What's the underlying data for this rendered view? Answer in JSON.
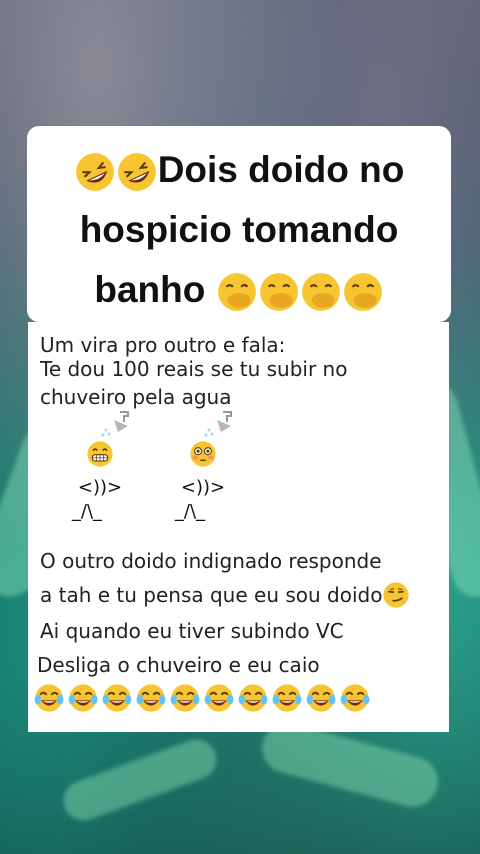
{
  "title": {
    "text": "Dois doido no hospicio tomando banho"
  },
  "body": {
    "line1": "Um vira pro outro e fala:",
    "line2": "Te dou 100 reais se tu subir no",
    "line3": "chuveiro pela agua",
    "figure_body": "<))>",
    "figure_legs": "_/\\_",
    "line4": "O outro doido indignado responde",
    "line5": "a tah e tu pensa que eu sou doido",
    "line6": "Ai quando eu tiver subindo VC",
    "line7": "Desliga o chuveiro e eu caio"
  },
  "icons": {
    "laughing": "rolling-on-floor-laughing-icon",
    "hand_over_mouth": "face-with-hand-over-mouth-icon",
    "grimacing": "grimacing-face-icon",
    "flushed": "flushed-face-icon",
    "smirk": "smirking-face-icon",
    "tears_of_joy": "face-with-tears-of-joy-icon",
    "shower": "shower-icon"
  },
  "colors": {
    "emoji_yellow": "#f7c531",
    "text": "#222222"
  }
}
